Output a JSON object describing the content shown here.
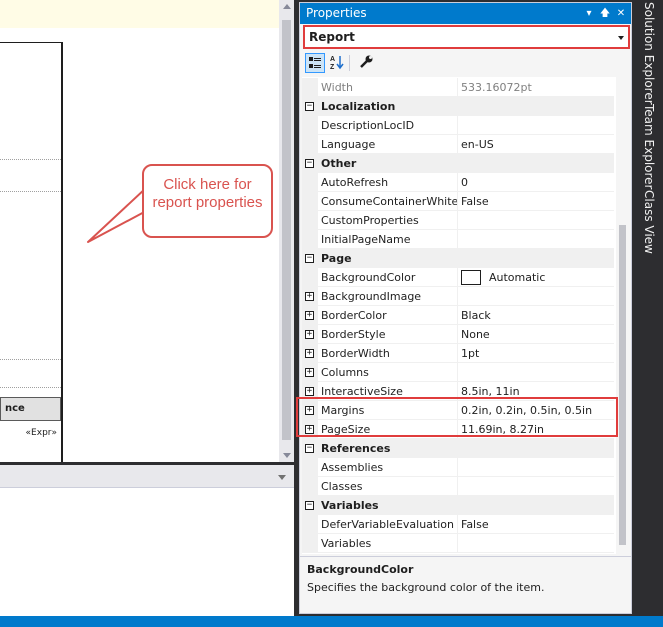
{
  "designer": {
    "table_header": "nce",
    "table_expr": "«Expr»"
  },
  "callout": {
    "text": "Click here for report properties"
  },
  "properties": {
    "title": "Properties",
    "title_buttons": [
      "▾",
      "🡅",
      "✕"
    ],
    "object": "Report",
    "rows": [
      {
        "type": "prop",
        "name": "Width",
        "value": "533.16072pt",
        "disabled": true
      },
      {
        "type": "cat",
        "name": "Localization"
      },
      {
        "type": "prop",
        "name": "DescriptionLocID",
        "value": ""
      },
      {
        "type": "prop",
        "name": "Language",
        "value": "en-US"
      },
      {
        "type": "cat",
        "name": "Other"
      },
      {
        "type": "prop",
        "name": "AutoRefresh",
        "value": "0"
      },
      {
        "type": "prop",
        "name": "ConsumeContainerWhite",
        "value": "False"
      },
      {
        "type": "prop",
        "name": "CustomProperties",
        "value": ""
      },
      {
        "type": "prop",
        "name": "InitialPageName",
        "value": ""
      },
      {
        "type": "cat",
        "name": "Page"
      },
      {
        "type": "prop",
        "name": "BackgroundColor",
        "value": "Automatic",
        "swatch": true
      },
      {
        "type": "prop",
        "name": "BackgroundImage",
        "value": "",
        "expandable": true
      },
      {
        "type": "prop",
        "name": "BorderColor",
        "value": "Black",
        "expandable": true
      },
      {
        "type": "prop",
        "name": "BorderStyle",
        "value": "None",
        "expandable": true
      },
      {
        "type": "prop",
        "name": "BorderWidth",
        "value": "1pt",
        "expandable": true
      },
      {
        "type": "prop",
        "name": "Columns",
        "value": "",
        "expandable": true
      },
      {
        "type": "prop",
        "name": "InteractiveSize",
        "value": "8.5in, 11in",
        "expandable": true
      },
      {
        "type": "prop",
        "name": "Margins",
        "value": "0.2in, 0.2in, 0.5in, 0.5in",
        "expandable": true
      },
      {
        "type": "prop",
        "name": "PageSize",
        "value": "11.69in, 8.27in",
        "expandable": true
      },
      {
        "type": "cat",
        "name": "References"
      },
      {
        "type": "prop",
        "name": "Assemblies",
        "value": ""
      },
      {
        "type": "prop",
        "name": "Classes",
        "value": ""
      },
      {
        "type": "cat",
        "name": "Variables"
      },
      {
        "type": "prop",
        "name": "DeferVariableEvaluation",
        "value": "False"
      },
      {
        "type": "prop",
        "name": "Variables",
        "value": ""
      }
    ],
    "description_title": "BackgroundColor",
    "description_text": "Specifies the background color of the item."
  },
  "side_tabs": [
    "Solution Explorer",
    "Team Explorer",
    "Class View"
  ],
  "colors": {
    "accent": "#007acc",
    "callout": "#d9534f",
    "highlight": "#e03c3c"
  }
}
